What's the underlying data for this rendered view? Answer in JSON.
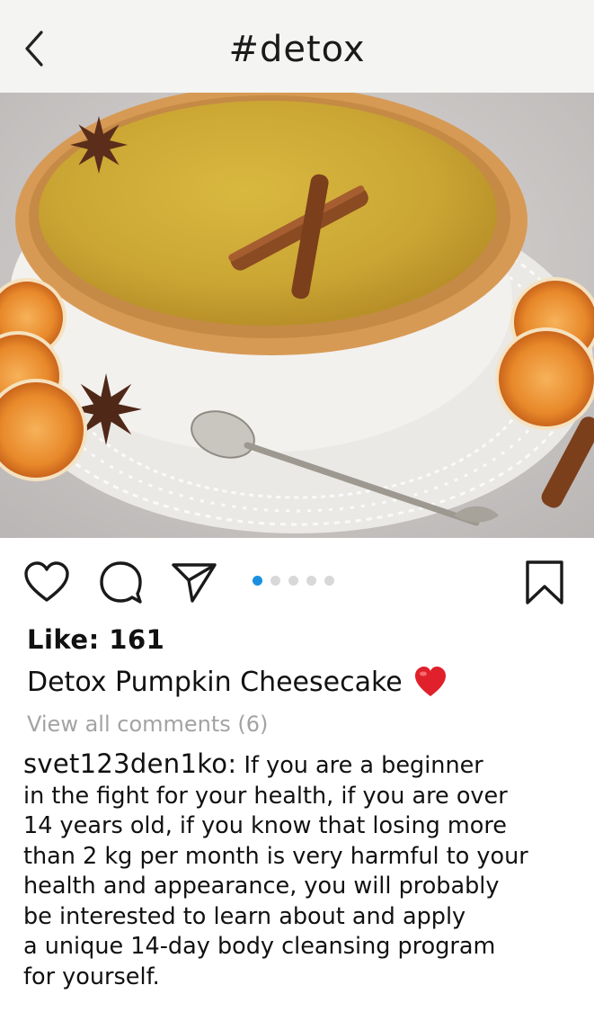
{
  "header": {
    "title": "#detox",
    "back_icon": "chevron-left-icon"
  },
  "post": {
    "image_description_icon": "photo",
    "carousel": {
      "count": 5,
      "active_index": 0
    },
    "actions": {
      "like_icon": "heart-outline-icon",
      "comment_icon": "speech-bubble-icon",
      "share_icon": "paper-plane-icon",
      "save_icon": "bookmark-icon"
    },
    "likes_text": "Like: 161",
    "caption_title": "Detox Pumpkin Cheesecake",
    "caption_emoji": "red-heart-emoji",
    "view_comments": "View all comments (6)",
    "comment": {
      "username": "svet123den1ko:",
      "lines": [
        " If you are a beginner",
        "in the fight for your health, if you are over",
        "14 years old, if you know that losing more",
        "than 2 kg per month is very harmful to your",
        "health and appearance, you will probably",
        "be interested to learn about and apply",
        "a unique 14-day body cleansing program",
        "for yourself."
      ]
    }
  },
  "colors": {
    "header_bg": "#f4f4f3",
    "accent_dot": "#1a8fe0",
    "heart_red": "#e0202b",
    "muted_text": "#a3a3a3"
  }
}
